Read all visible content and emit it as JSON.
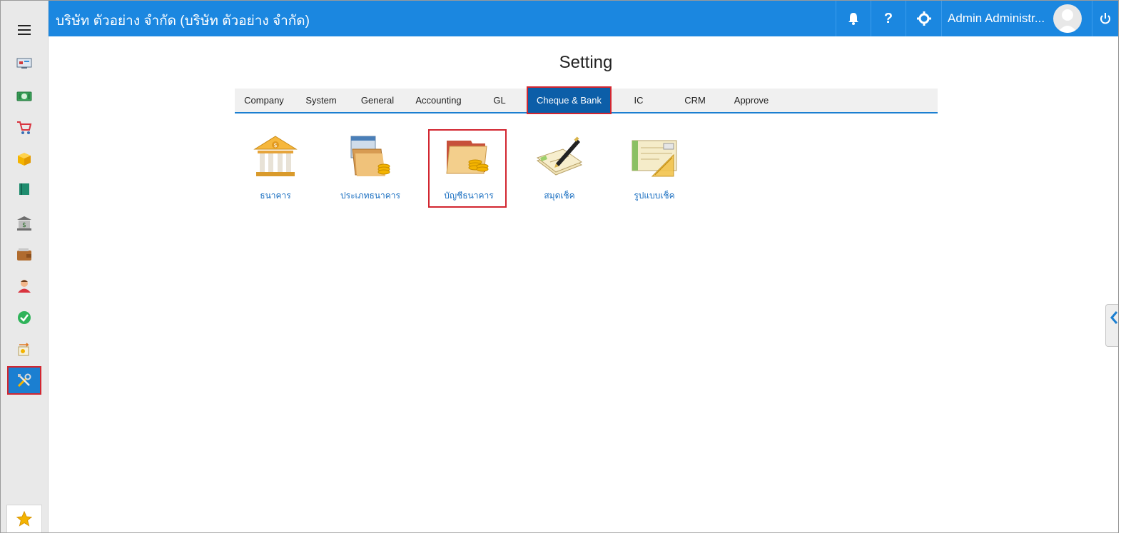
{
  "header": {
    "company": "บริษัท ตัวอย่าง จำกัด (บริษัท ตัวอย่าง จำกัด)",
    "user_name": "Admin Administr...",
    "icons": [
      "bell-icon",
      "help-icon",
      "gear-icon",
      "power-icon"
    ]
  },
  "sidebar": {
    "items": [
      {
        "name": "dashboard-icon"
      },
      {
        "name": "money-icon"
      },
      {
        "name": "cart-icon"
      },
      {
        "name": "box-icon"
      },
      {
        "name": "book-icon"
      },
      {
        "name": "bank-icon"
      },
      {
        "name": "wallet-icon"
      },
      {
        "name": "people-icon"
      },
      {
        "name": "check-icon"
      },
      {
        "name": "transfer-icon"
      },
      {
        "name": "tools-icon",
        "active": true
      }
    ],
    "favorite": "star-icon"
  },
  "main": {
    "title": "Setting",
    "tabs": [
      {
        "label": "Company"
      },
      {
        "label": "System"
      },
      {
        "label": "General"
      },
      {
        "label": "Accounting"
      },
      {
        "label": "GL"
      },
      {
        "label": "Cheque & Bank",
        "active": true
      },
      {
        "label": "IC"
      },
      {
        "label": "CRM"
      },
      {
        "label": "Approve"
      }
    ],
    "tiles": [
      {
        "label": "ธนาคาร",
        "icon": "bank-building-icon"
      },
      {
        "label": "ประเภทธนาคาร",
        "icon": "bank-type-icon"
      },
      {
        "label": "บัญชีธนาคาร",
        "icon": "bank-account-icon",
        "highlight": true
      },
      {
        "label": "สมุดเช็ค",
        "icon": "cheque-book-icon"
      },
      {
        "label": "รูปแบบเช็ค",
        "icon": "cheque-format-icon"
      }
    ]
  },
  "colors": {
    "header": "#1b87e0",
    "active_tab": "#0c5ea8",
    "highlight": "#d22630",
    "link": "#1a6fc1"
  }
}
